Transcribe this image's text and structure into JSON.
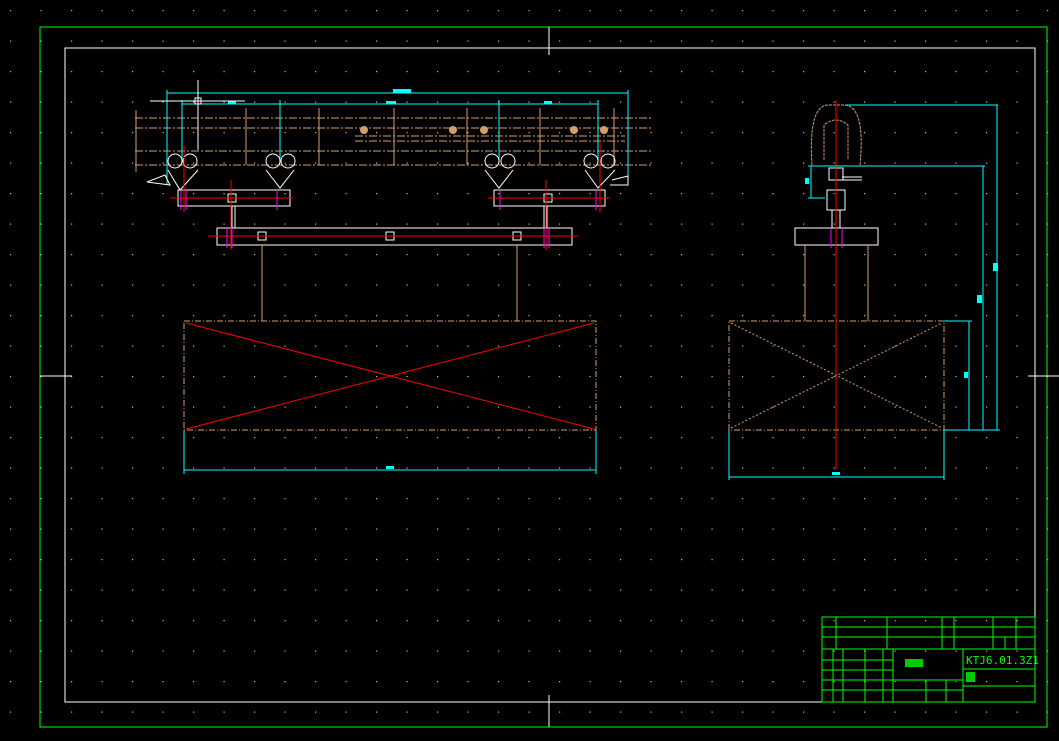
{
  "drawing": {
    "type": "CAD mechanical drawing",
    "background": "#000000",
    "colors": {
      "frame": "#00ff00",
      "border": "#ffffff",
      "dimension": "#00ffff",
      "centerline": "#ff0000",
      "hidden": "#ff00ff",
      "structure": "#d2a06e"
    },
    "views": [
      "front-view",
      "side-view"
    ]
  },
  "title_block": {
    "drawing_number": "KTJ6.01.3Z1"
  }
}
